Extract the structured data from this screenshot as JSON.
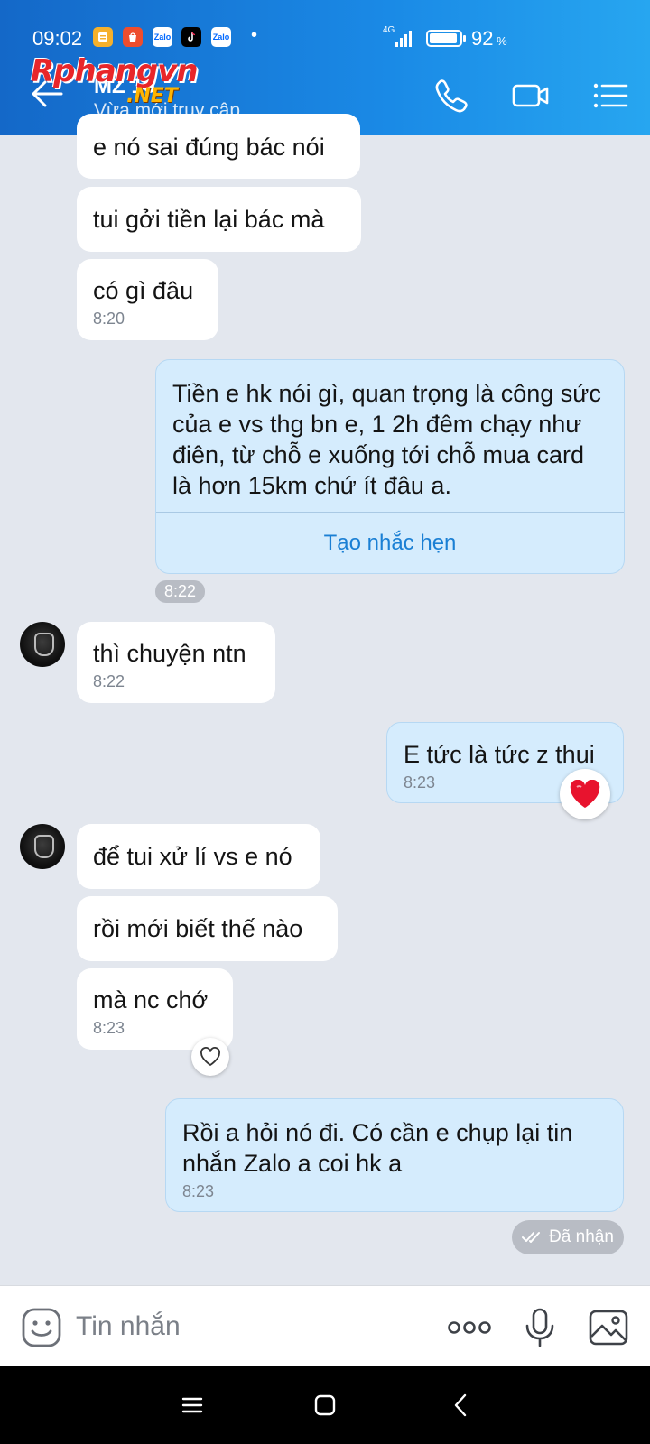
{
  "status_bar": {
    "time": "09:02",
    "network": "4G",
    "battery_percent": "92",
    "battery_unit": "%",
    "dot": "•",
    "apps": [
      "notes-app",
      "shopee-app",
      "zalo-app",
      "tiktok-app",
      "zalo-app"
    ],
    "app_labels": [
      "",
      "",
      "Zalo",
      "",
      "Zalo"
    ]
  },
  "header": {
    "contact_name": "MZ 16",
    "presence": "Vừa mới truy cập",
    "watermark_main": "Rphangvn",
    "watermark_sub": ".NET"
  },
  "messages": [
    {
      "side": "them",
      "text": "e nó sai đúng bác nói",
      "time": ""
    },
    {
      "side": "them",
      "text": "tui gởi tiền lại bác mà",
      "time": ""
    },
    {
      "side": "them",
      "text": "có gì đâu",
      "time": "8:20"
    },
    {
      "side": "me",
      "text": "Tiền e hk nói gì, quan trọng là công sức của e vs thg bn e, 1 2h đêm chạy như điên, từ chỗ e xuống tới chỗ mua card là hơn 15km chứ ít đâu a.",
      "action": "Tạo nhắc hẹn",
      "time": "8:22"
    },
    {
      "side": "them",
      "text": "thì chuyện ntn",
      "time": "8:22"
    },
    {
      "side": "me",
      "text": "E tức là tức z thui",
      "time": "8:23",
      "reaction": "red-heart-icon"
    },
    {
      "side": "them",
      "text": "để tui xử lí vs e nó",
      "time": ""
    },
    {
      "side": "them",
      "text": "rồi mới biết thế nào",
      "time": ""
    },
    {
      "side": "them",
      "text": "mà nc chớ",
      "time": "8:23",
      "reaction": "heart-outline-icon"
    },
    {
      "side": "me",
      "text": "Rồi a hỏi nó đi. Có cần e chụp lại tin nhắn Zalo a coi hk a",
      "time": "8:23"
    }
  ],
  "delivery_status": "Đã nhận",
  "composer": {
    "placeholder": "Tin nhắn",
    "icons": [
      "emoji-icon",
      "more-options-icon",
      "microphone-icon",
      "image-gallery-icon"
    ]
  },
  "colors": {
    "header_start": "#1468c8",
    "header_end": "#27a6f0",
    "my_bubble": "#d5ecfd",
    "their_bubble": "#ffffff",
    "chat_bg": "#e3e7ee",
    "link": "#1a7fd4",
    "heart": "#e8132e"
  }
}
